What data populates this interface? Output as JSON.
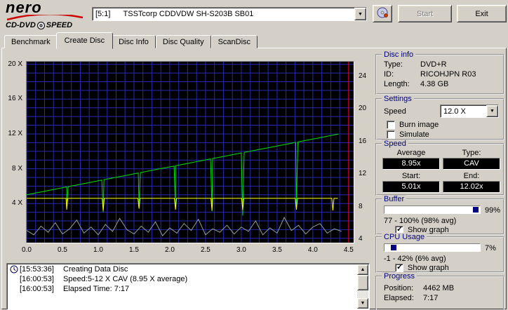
{
  "logo": {
    "line1": "nero",
    "line2_left": "CD-DVD",
    "line2_right": "SPEED"
  },
  "toolbar": {
    "drive": "[5:1]      TSSTcorp CDDVDW SH-S203B SB01",
    "start_label": "Start",
    "start_disabled": true,
    "exit_label": "Exit"
  },
  "tabs": [
    {
      "label": "Benchmark",
      "active": false
    },
    {
      "label": "Create Disc",
      "active": true
    },
    {
      "label": "Disc Info",
      "active": false
    },
    {
      "label": "Disc Quality",
      "active": false
    },
    {
      "label": "ScanDisc",
      "active": false
    }
  ],
  "chart_data": {
    "type": "line",
    "title": "Create Disc write speed graph",
    "x_axis": {
      "unit": "GB",
      "min": 0,
      "max": 4.57,
      "ticks": [
        "0.0",
        "0.5",
        "1.0",
        "1.5",
        "2.0",
        "2.5",
        "3.0",
        "3.5",
        "4.0",
        "4.5"
      ],
      "tick_values": [
        0,
        0.5,
        1,
        1.5,
        2,
        2.5,
        3,
        3.5,
        4,
        4.5
      ]
    },
    "y_axis_left": {
      "min": -0.5,
      "max": 20.3,
      "ticks": [
        "20 X",
        "16 X",
        "12 X",
        "8 X",
        "4 X"
      ],
      "tick_values": [
        20,
        16,
        12,
        8,
        4
      ]
    },
    "y_axis_right": {
      "min": 3.6,
      "max": 25.8,
      "ticks": [
        "24",
        "20",
        "16",
        "12",
        "8",
        "4"
      ],
      "tick_values": [
        24,
        20,
        16,
        12,
        8,
        4
      ]
    },
    "grid": {
      "x_step": 0.125,
      "y_step": 1,
      "color": "#2828b0"
    },
    "plot_bg": "#000000",
    "series": [
      {
        "name": "write-speed",
        "color": "#00e000",
        "type": "cav",
        "start_x": 0,
        "start_y": 5.01,
        "end_x": 4.38,
        "end_y": 12.02,
        "spikes": [
          {
            "x": 0.56,
            "low": 3.6
          },
          {
            "x": 1.07,
            "low": 3.0
          },
          {
            "x": 1.57,
            "low": 3.9
          },
          {
            "x": 2.08,
            "low": 3.4
          },
          {
            "x": 2.59,
            "low": 3.1
          },
          {
            "x": 3.02,
            "low": 2.6
          },
          {
            "x": 3.77,
            "low": 3.7
          }
        ]
      },
      {
        "name": "buffer-level",
        "color": "#ffff00",
        "type": "flat",
        "base": 4.6,
        "end_x": 4.35,
        "spikes": [
          {
            "x": 0.56,
            "low": 3.3
          },
          {
            "x": 1.07,
            "low": 3.2
          },
          {
            "x": 1.57,
            "low": 3.4
          },
          {
            "x": 2.08,
            "low": 3.3
          },
          {
            "x": 2.59,
            "low": 3.2
          },
          {
            "x": 3.02,
            "low": 3.3
          },
          {
            "x": 3.77,
            "low": 3.3
          },
          {
            "x": 4.28,
            "low": 3.2
          }
        ]
      },
      {
        "name": "cpu-usage",
        "color": "#90a090",
        "type": "samples",
        "x_step": 0.1,
        "values": [
          0.9,
          0.4,
          1.4,
          0.7,
          1.8,
          0.5,
          1.1,
          2.1,
          0.6,
          1.3,
          0.4,
          1.6,
          0.8,
          2.3,
          1.0,
          0.5,
          1.4,
          0.7,
          1.9,
          0.3,
          1.2,
          0.6,
          1.7,
          0.9,
          2.2,
          0.4,
          1.1,
          0.7,
          1.5,
          0.5,
          1.3,
          0.8,
          2.0,
          0.4,
          1.2,
          0.6,
          2.4,
          0.9,
          1.5,
          0.5,
          1.3,
          1.7,
          0.6,
          1.1,
          0.8
        ]
      }
    ],
    "marker_line": {
      "x": 4.5,
      "color": "#ff0000"
    }
  },
  "disc_info": {
    "title": "Disc info",
    "type_label": "Type:",
    "type": "DVD+R",
    "id_label": "ID:",
    "id": "RICOHJPN R03",
    "length_label": "Length:",
    "length": "4.38 GB"
  },
  "settings": {
    "title": "Settings",
    "speed_label": "Speed",
    "speed_value": "12.0 X",
    "burn_image_label": "Burn image",
    "burn_image_checked": false,
    "simulate_label": "Simulate",
    "simulate_checked": false
  },
  "speed": {
    "title": "Speed",
    "average_label": "Average",
    "type_label": "Type:",
    "average": "8.95x",
    "type": "CAV",
    "start_label": "Start:",
    "end_label": "End:",
    "start": "5.01x",
    "end": "12.02x"
  },
  "buffer": {
    "title": "Buffer",
    "percent": "99%",
    "percent_value": 99,
    "range": "77 - 100% (98% avg)",
    "show_graph_label": "Show graph",
    "show_graph_checked": true
  },
  "cpu": {
    "title": "CPU Usage",
    "percent": "7%",
    "percent_value": 7,
    "range": "-1 - 42% (6% avg)",
    "show_graph_label": "Show graph",
    "show_graph_checked": true
  },
  "progress": {
    "title": "Progress",
    "position_label": "Position:",
    "position": "4462 MB",
    "elapsed_label": "Elapsed:",
    "elapsed": "7:17"
  },
  "log": {
    "rows": [
      {
        "time": "[15:53:36]",
        "message": "Creating Data Disc"
      },
      {
        "time": "[16:00:53]",
        "message": "Speed:5-12 X CAV (8.95 X average)"
      },
      {
        "time": "[16:00:53]",
        "message": "Elapsed Time: 7:17"
      }
    ]
  }
}
